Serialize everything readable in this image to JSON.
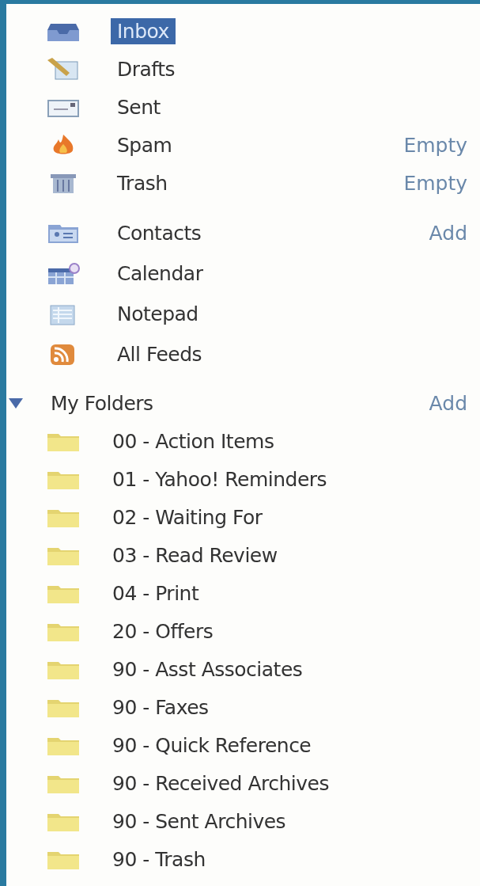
{
  "mail_folders": [
    {
      "kind": "inbox",
      "label": "Inbox",
      "selected": true
    },
    {
      "kind": "drafts",
      "label": "Drafts",
      "selected": false
    },
    {
      "kind": "sent",
      "label": "Sent",
      "selected": false
    },
    {
      "kind": "spam",
      "label": "Spam",
      "selected": false,
      "action": "Empty"
    },
    {
      "kind": "trash",
      "label": "Trash",
      "selected": false,
      "action": "Empty"
    }
  ],
  "tools": [
    {
      "kind": "contacts",
      "label": "Contacts",
      "selected": false,
      "action": "Add"
    },
    {
      "kind": "calendar",
      "label": "Calendar",
      "selected": false
    },
    {
      "kind": "notepad",
      "label": "Notepad",
      "selected": false
    },
    {
      "kind": "feeds",
      "label": "All Feeds",
      "selected": false
    }
  ],
  "my_folders": {
    "label": "My Folders",
    "expanded": true,
    "action": "Add",
    "folders": [
      {
        "label": "00 - Action Items",
        "selected": false
      },
      {
        "label": "01 - Yahoo! Reminders",
        "selected": false
      },
      {
        "label": "02 - Waiting For",
        "selected": false
      },
      {
        "label": "03 - Read Review",
        "selected": false
      },
      {
        "label": "04 - Print",
        "selected": false
      },
      {
        "label": "20 - Offers",
        "selected": false
      },
      {
        "label": "90 - Asst Associates",
        "selected": false
      },
      {
        "label": "90 - Faxes",
        "selected": false
      },
      {
        "label": "90 - Quick Reference",
        "selected": false
      },
      {
        "label": "90 - Received Archives",
        "selected": false
      },
      {
        "label": "90 - Sent Archives",
        "selected": false
      },
      {
        "label": "90 - Trash",
        "selected": false
      }
    ]
  }
}
